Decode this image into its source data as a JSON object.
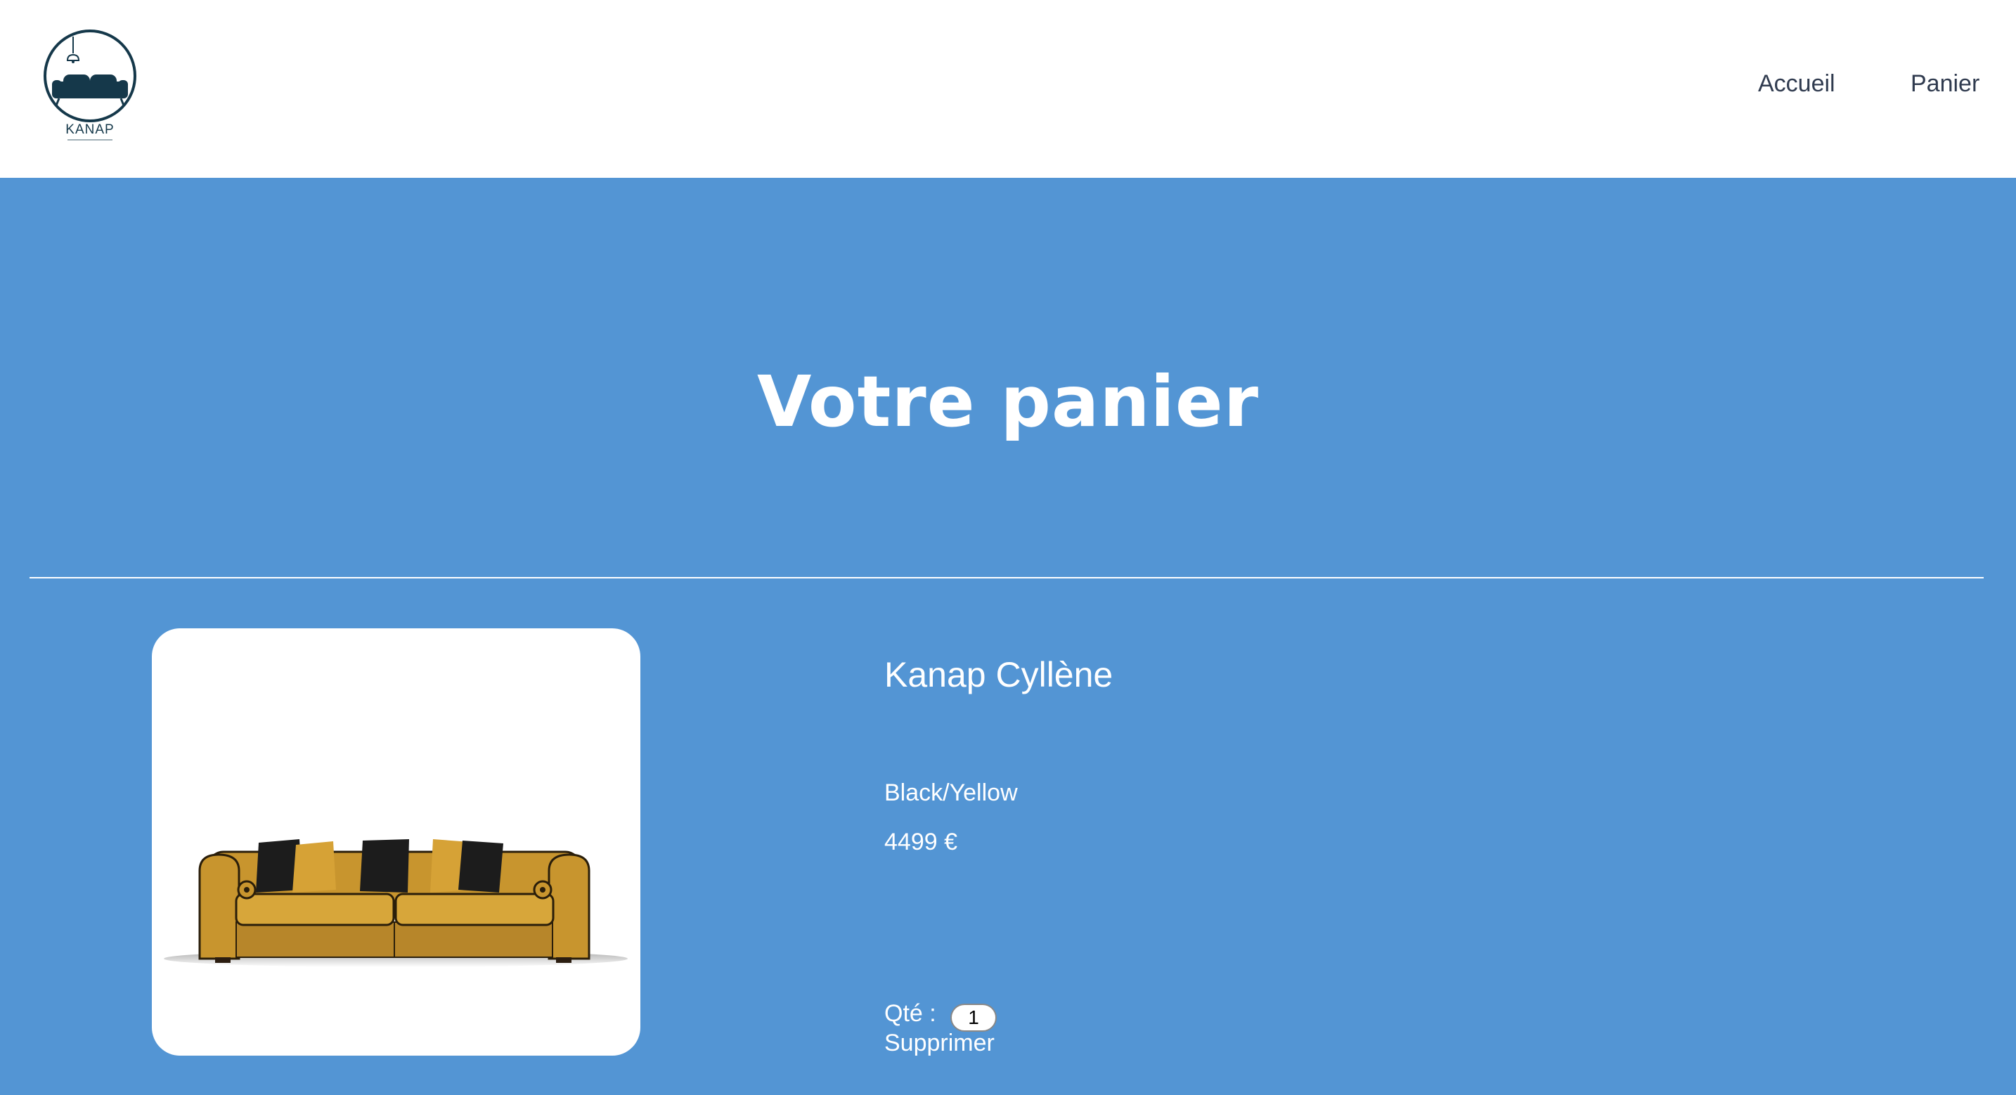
{
  "header": {
    "logo_text": "KANAP",
    "nav": {
      "home_label": "Accueil",
      "cart_label": "Panier"
    }
  },
  "main": {
    "title": "Votre panier",
    "cart_items": [
      {
        "image_icon": "sofa-image",
        "name": "Kanap Cyllène",
        "color": "Black/Yellow",
        "price": "4499 €",
        "quantity_label": "Qté :",
        "quantity": "1",
        "delete_label": "Supprimer"
      }
    ]
  },
  "colors": {
    "header_background": "#ffffff",
    "main_background": "#5395d4",
    "text_on_main": "#ffffff",
    "nav_text": "#303b4f",
    "logo": "#15384a"
  }
}
